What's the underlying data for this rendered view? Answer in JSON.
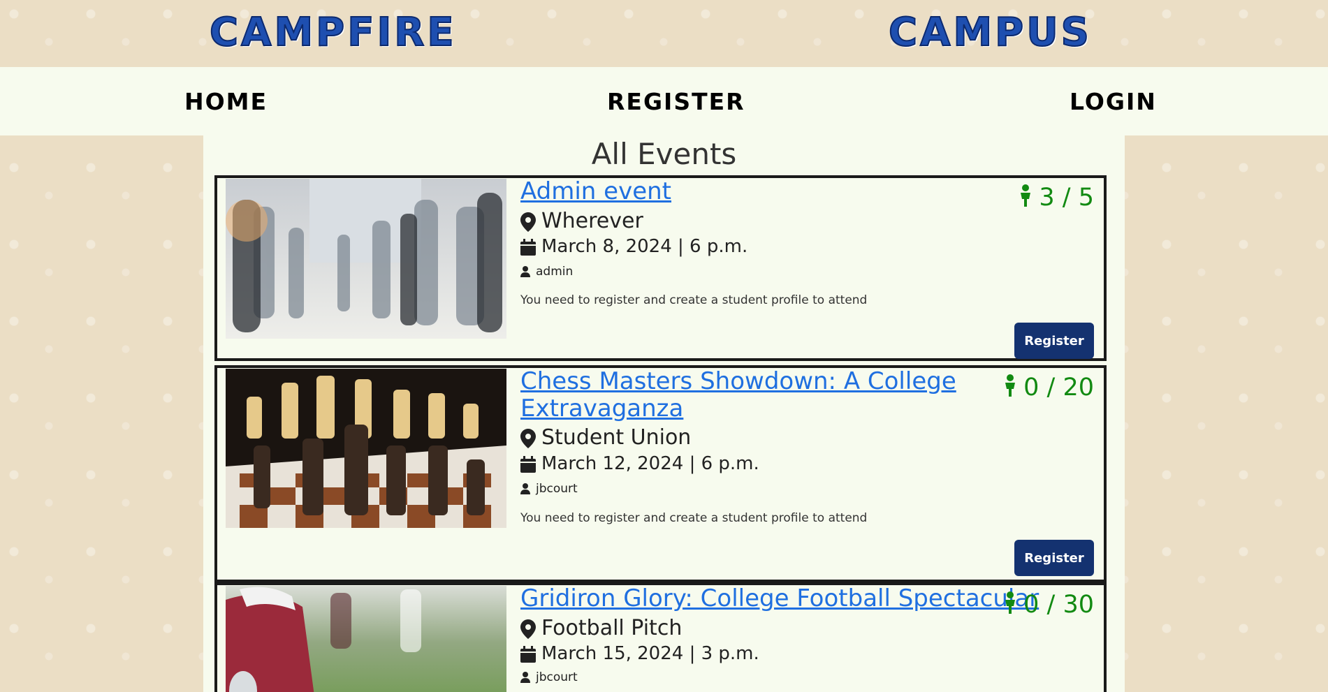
{
  "brand": {
    "left": "CAMPFIRE",
    "right": "CAMPUS"
  },
  "nav": {
    "home": "HOME",
    "register": "REGISTER",
    "login": "LOGIN"
  },
  "page_title": "All Events",
  "events": [
    {
      "title": "Admin event",
      "attendance": "3 / 5",
      "location": "Wherever",
      "datetime": "March 8, 2024 | 6 p.m.",
      "author": "admin",
      "notice": "You need to register and create a student profile to attend",
      "button": "Register",
      "image": "crowd-photo"
    },
    {
      "title": "Chess Masters Showdown: A College Extravaganza",
      "attendance": "0 / 20",
      "location": "Student Union",
      "datetime": "March 12, 2024 | 6 p.m.",
      "author": "jbcourt",
      "notice": "You need to register and create a student profile to attend",
      "button": "Register",
      "image": "chess-photo"
    },
    {
      "title": "Gridiron Glory: College Football Spectacular",
      "attendance": "0 / 30",
      "location": "Football Pitch",
      "datetime": "March 15, 2024 | 3 p.m.",
      "author": "jbcourt",
      "image": "football-photo"
    }
  ],
  "colors": {
    "link": "#1f6fe0",
    "attend": "#128a12",
    "button": "#143270",
    "panel": "#f7fbee",
    "bg": "#ebdec5"
  }
}
